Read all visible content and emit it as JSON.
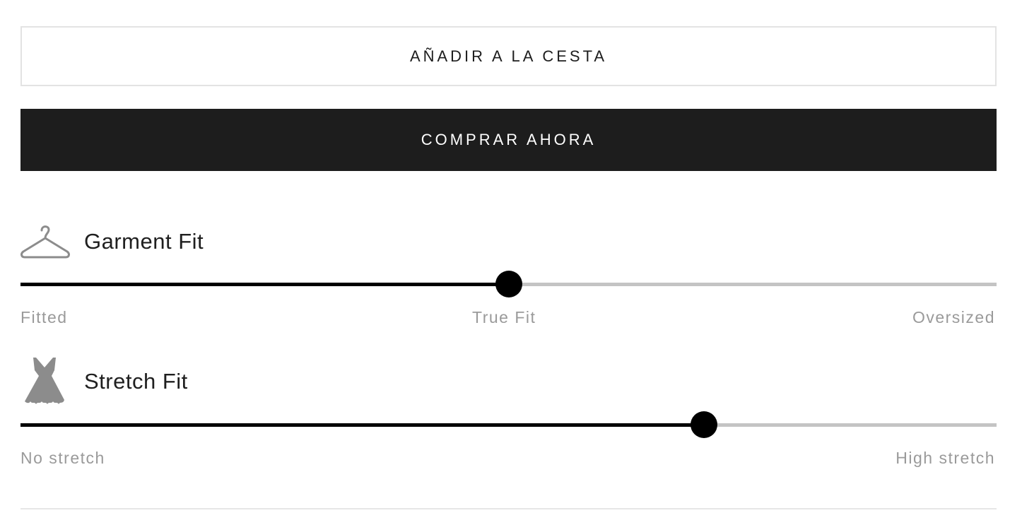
{
  "buttons": {
    "add_to_cart": "AÑADIR A LA CESTA",
    "buy_now": "COMPRAR AHORA"
  },
  "garment_fit": {
    "title": "Garment Fit",
    "icon": "hanger-icon",
    "value_fraction": 0.5,
    "labels": {
      "left": "Fitted",
      "center": "True Fit",
      "right": "Oversized"
    }
  },
  "stretch_fit": {
    "title": "Stretch Fit",
    "icon": "dress-icon",
    "value_fraction": 0.7,
    "labels": {
      "left": "No stretch",
      "right": "High stretch"
    }
  },
  "colors": {
    "primary": "#1d1d1d",
    "track_fill": "#000000",
    "track_empty": "#c4c4c4",
    "label_gray": "#9a9a9a",
    "icon_gray": "#8c8c8c"
  }
}
